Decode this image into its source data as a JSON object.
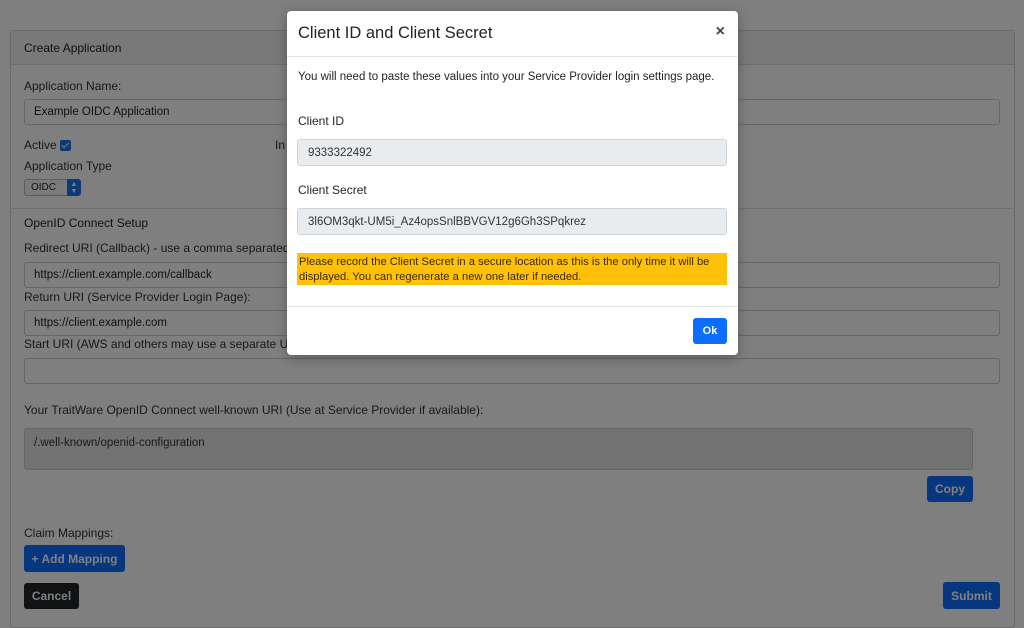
{
  "form": {
    "header": "Create Application",
    "app_name_label": "Application Name:",
    "app_name_value": "Example OIDC Application",
    "active_label": "Active",
    "hidden_label_fragment": "In",
    "app_type_label": "Application Type",
    "app_type_value": "OIDC",
    "oidc_section": "OpenID Connect Setup",
    "redirect_label": "Redirect URI (Callback) - use a comma separated li",
    "redirect_value": "https://client.example.com/callback",
    "return_label": "Return URI (Service Provider Login Page):",
    "return_value": "https://client.example.com",
    "start_label": "Start URI (AWS and others may use a separate URI",
    "start_value": "",
    "wellknown_label": "Your TraitWare OpenID Connect well-known URI (Use at Service Provider if available):",
    "wellknown_value": "/.well-known/openid-configuration",
    "copy_label": "Copy",
    "claim_label": "Claim Mappings:",
    "add_mapping_label": "+ Add Mapping",
    "cancel_label": "Cancel",
    "submit_label": "Submit"
  },
  "modal": {
    "title": "Client ID and Client Secret",
    "close_glyph": "×",
    "intro": "You will need to paste these values into your Service Provider login settings page.",
    "client_id_label": "Client ID",
    "client_id_value": "9333322492",
    "client_secret_label": "Client Secret",
    "client_secret_value": "3l6OM3qkt-UM5i_Az4opsSnlBBVGV12g6Gh3SPqkrez",
    "warning": "Please record the Client Secret in a secure location as this is the only time it will be displayed. You can regenerate a new one later if needed.",
    "ok_label": "Ok"
  },
  "colors": {
    "primary": "#0d6efd",
    "warning": "#ffc107",
    "dark": "#212529"
  }
}
